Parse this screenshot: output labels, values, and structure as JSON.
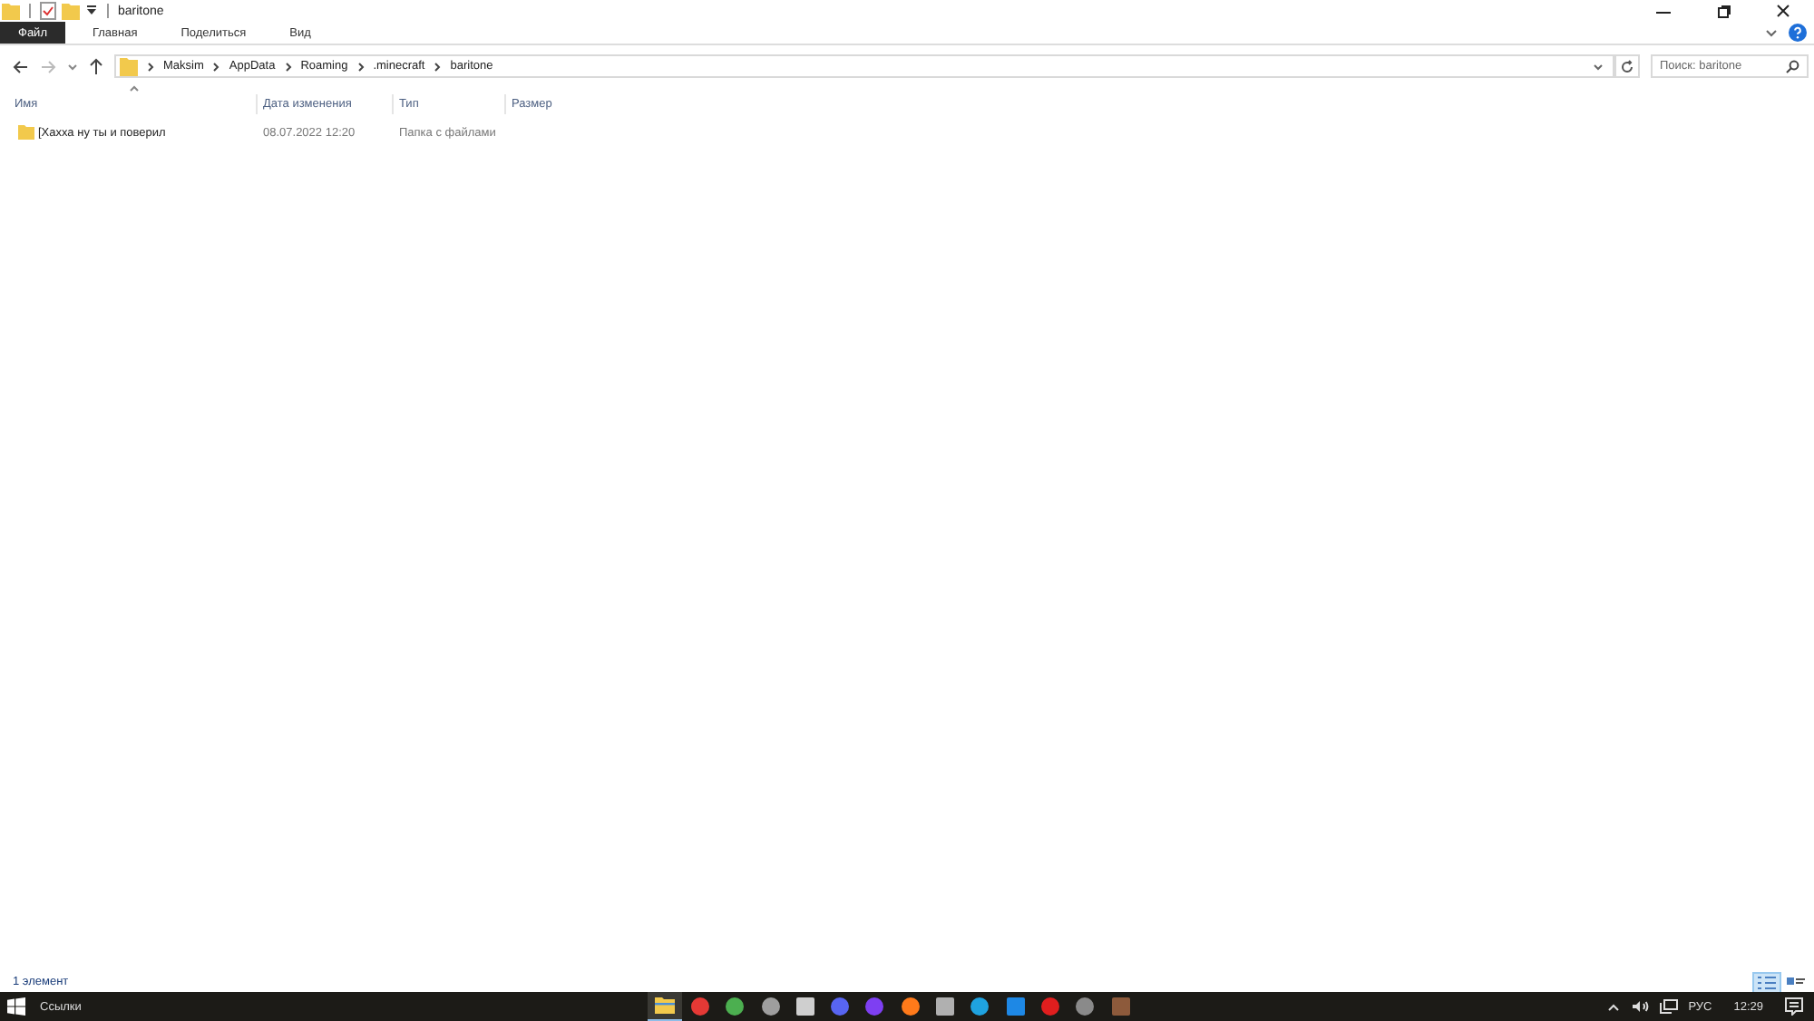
{
  "window": {
    "title": "baritone"
  },
  "ribbon_tabs": [
    {
      "label": "Файл",
      "selected": true
    },
    {
      "label": "Главная",
      "selected": false
    },
    {
      "label": "Поделиться",
      "selected": false
    },
    {
      "label": "Вид",
      "selected": false
    }
  ],
  "address": {
    "path": [
      "Maksim",
      "AppData",
      "Roaming",
      ".minecraft",
      "baritone"
    ]
  },
  "search": {
    "placeholder": "Поиск: baritone"
  },
  "columns": [
    "Имя",
    "Дата изменения",
    "Тип",
    "Размер"
  ],
  "rows": [
    {
      "name": "[Хахха ну ты и поверил",
      "date": "08.07.2022 12:20",
      "type": "Папка с файлами"
    }
  ],
  "status_bar": {
    "count": "1 элемент"
  },
  "taskbar": {
    "search_label": "Ссылки",
    "apps": [
      {
        "kind": "folder",
        "color": "#f2c94c",
        "active": true
      },
      {
        "kind": "circle",
        "color": "#e53935",
        "active": false
      },
      {
        "kind": "circle",
        "color": "#4caf50",
        "active": false
      },
      {
        "kind": "circle",
        "color": "#9e9e9e",
        "active": false
      },
      {
        "kind": "square",
        "color": "#cfcfcf",
        "active": false
      },
      {
        "kind": "circle",
        "color": "#5865f2",
        "active": false
      },
      {
        "kind": "circle",
        "color": "#7e3ff2",
        "active": false
      },
      {
        "kind": "circle",
        "color": "#ff7a1a",
        "active": false
      },
      {
        "kind": "square",
        "color": "#b0b0b0",
        "active": false
      },
      {
        "kind": "circle",
        "color": "#1fa3e0",
        "active": false
      },
      {
        "kind": "square",
        "color": "#1e88e5",
        "active": false
      },
      {
        "kind": "circle",
        "color": "#e01e1e",
        "active": false
      },
      {
        "kind": "circle",
        "color": "#8a8a8a",
        "active": false
      },
      {
        "kind": "square",
        "color": "#8d5a3b",
        "active": false
      }
    ],
    "language": "РУС",
    "time": "12:29"
  }
}
